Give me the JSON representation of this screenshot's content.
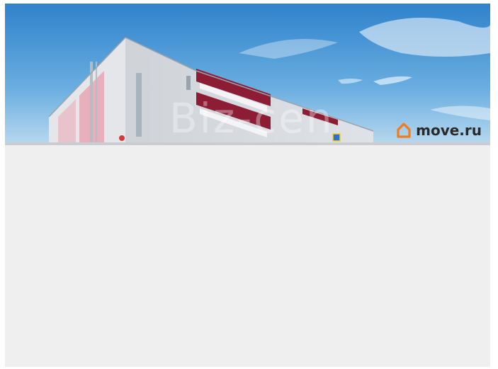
{
  "photo": {
    "watermark_text": "Biz-cen",
    "logo_text": "move.ru",
    "logo_icon": "house-outline-icon",
    "accent_color": "#f07c1b"
  }
}
